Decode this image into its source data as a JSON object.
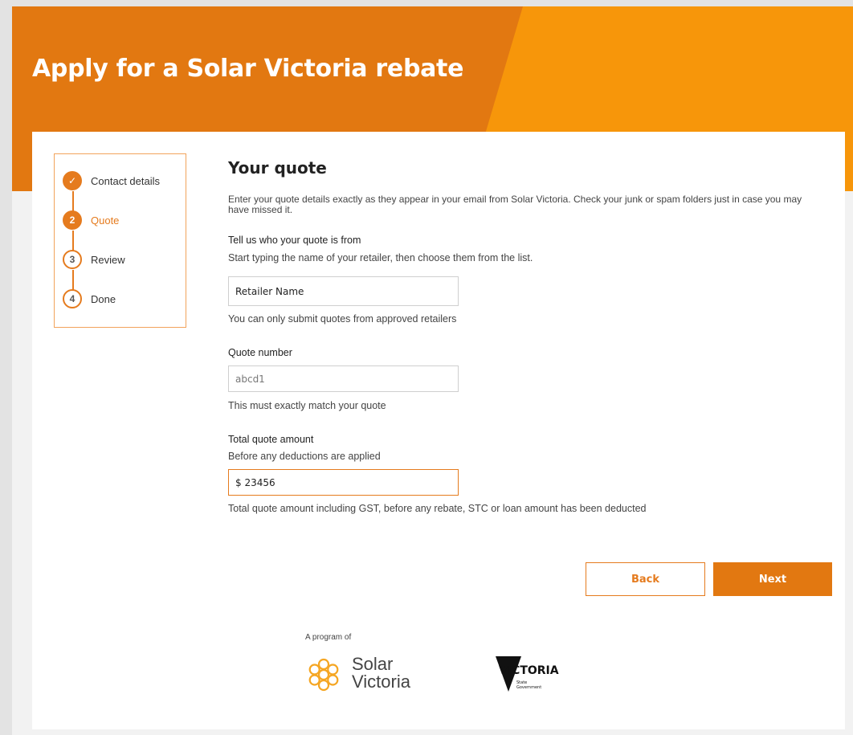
{
  "page": {
    "title": "Apply for a Solar Victoria rebate",
    "colors": {
      "brand_orange": "#e27811",
      "brand_light": "#f7960a"
    }
  },
  "stepper": {
    "steps": [
      {
        "number": "✓",
        "label": "Contact details",
        "state": "done"
      },
      {
        "number": "2",
        "label": "Quote",
        "state": "active"
      },
      {
        "number": "3",
        "label": "Review",
        "state": "todo"
      },
      {
        "number": "4",
        "label": "Done",
        "state": "todo"
      }
    ]
  },
  "form": {
    "title": "Your quote",
    "intro": "Enter your quote details exactly as they appear in your email from Solar Victoria. Check your junk or spam folders just in case you may have missed it.",
    "retailer": {
      "label": "Tell us who your quote is from",
      "hint": "Start typing the name of your retailer, then choose them from the list.",
      "value": "Retailer Name",
      "help": "You can only submit quotes from approved retailers"
    },
    "quote_number": {
      "label": "Quote number",
      "value": "abcd1",
      "help": "This must exactly match your quote"
    },
    "amount": {
      "label": "Total quote amount",
      "hint": "Before any deductions are applied",
      "value": "$ 23456",
      "help": "Total quote amount including GST, before any rebate, STC or loan amount has been deducted"
    }
  },
  "buttons": {
    "back": "Back",
    "next": "Next"
  },
  "footer": {
    "program_of": "A program of",
    "solar_victoria_line1": "Solar",
    "solar_victoria_line2": "Victoria",
    "victoria_logo_text": "VICTORIA",
    "victoria_logo_sub1": "State",
    "victoria_logo_sub2": "Government"
  }
}
